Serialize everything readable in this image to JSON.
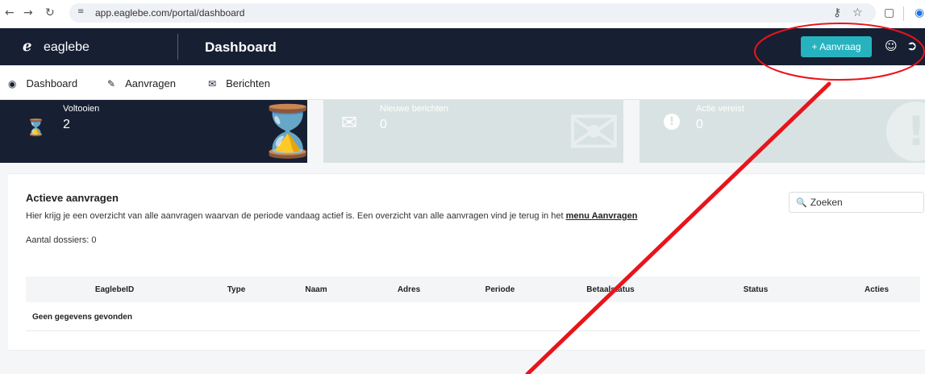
{
  "browser": {
    "url": "app.eaglebe.com/portal/dashboard",
    "icons": [
      "back-icon",
      "forward-icon",
      "reload-icon",
      "site-info-icon",
      "key-icon",
      "star-icon",
      "extensions-icon",
      "profile-icon"
    ]
  },
  "header": {
    "logo": "eaglebe",
    "title": "Dashboard",
    "new_request_label": "+ Aanvraag"
  },
  "tabs": [
    {
      "label": "Dashboard",
      "icon": "speedometer-icon"
    },
    {
      "label": "Aanvragen",
      "icon": "edit-icon"
    },
    {
      "label": "Berichten",
      "icon": "envelope-icon"
    }
  ],
  "cards": [
    {
      "label": "Voltooien",
      "value": "2",
      "icon": "hourglass-icon"
    },
    {
      "label": "Nieuwe berichten",
      "value": "0",
      "icon": "envelope-icon"
    },
    {
      "label": "Actie vereist",
      "value": "0",
      "icon": "exclamation-icon"
    }
  ],
  "section": {
    "title": "Actieve aanvragen",
    "description": "Hier krijg je een overzicht van alle aanvragen waarvan de periode vandaag actief is. Een overzicht van alle aanvragen vind je terug in het ",
    "link": "menu Aanvragen",
    "count_label": "Aantal dossiers: 0",
    "search_placeholder": "Zoeken"
  },
  "table": {
    "columns": [
      "EaglebeID",
      "Type",
      "Naam",
      "Adres",
      "Periode",
      "Betaalstatus",
      "Status",
      "Acties"
    ],
    "empty_message": "Geen gegevens gevonden"
  },
  "colors": {
    "navy": "#171f33",
    "teal": "#26b3bf",
    "annotation_red": "#e8141c"
  }
}
